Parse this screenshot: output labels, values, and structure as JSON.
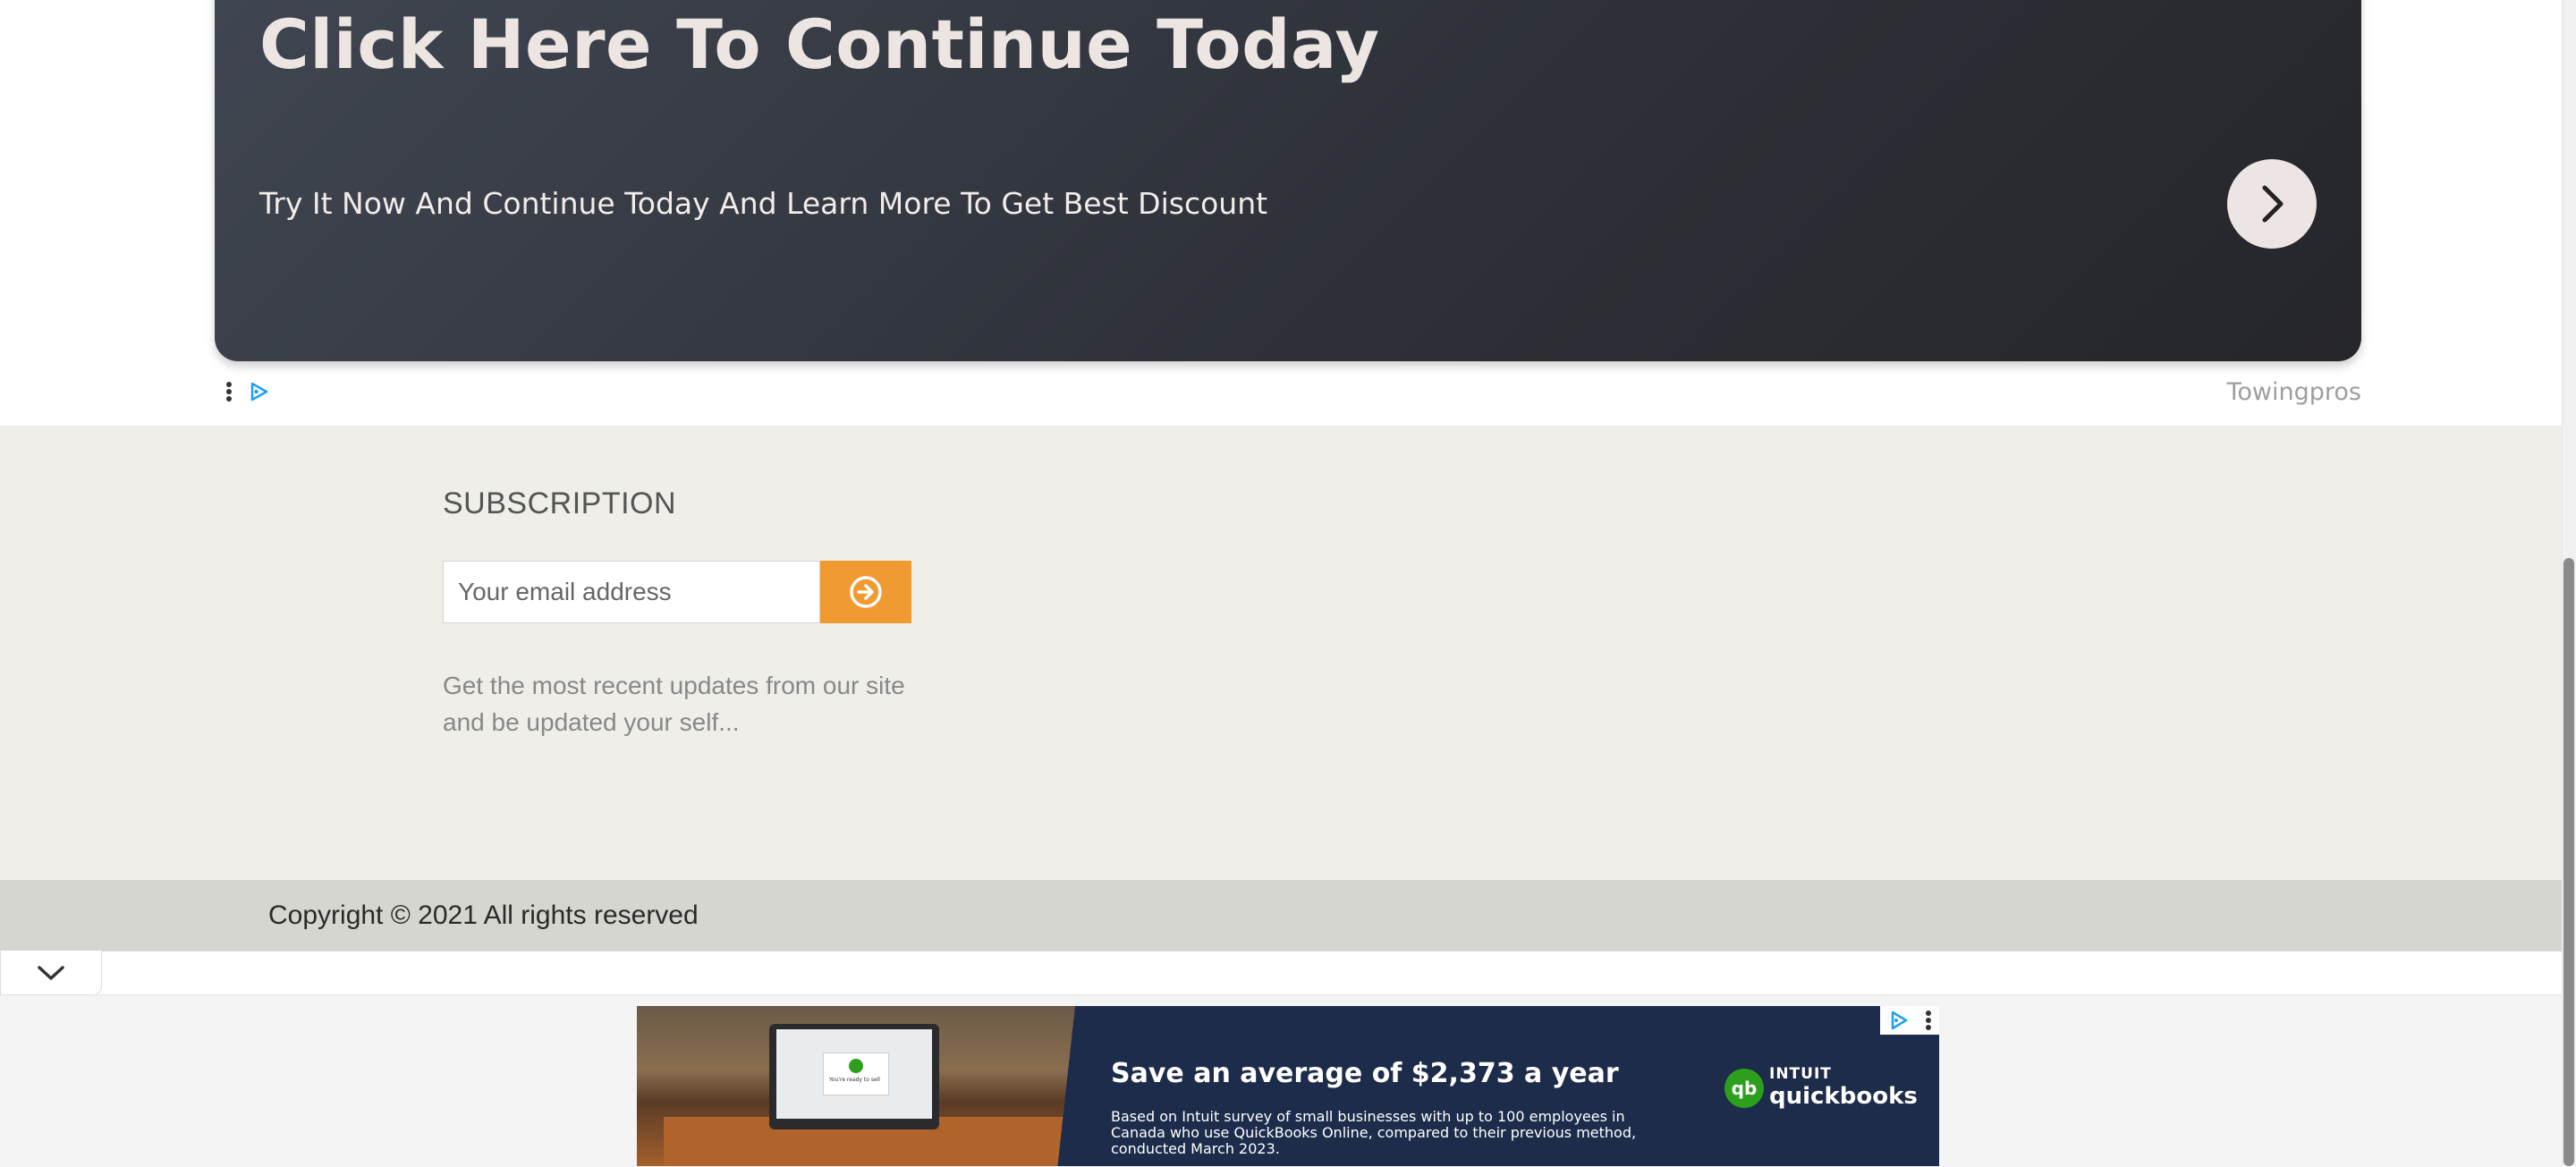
{
  "native_ad": {
    "headline": "Click Here To Continue Today",
    "subtext": "Try It Now And Continue Today And Learn More To Get Best Discount",
    "advertiser": "Towingpros",
    "cta_icon": "chevron-right-icon"
  },
  "subscription": {
    "title": "SUBSCRIPTION",
    "email_placeholder": "Your email address",
    "submit_icon": "arrow-circle-right-icon",
    "description": "Get the most recent updates from our site and be updated your self..."
  },
  "footer": {
    "copyright": "Copyright © 2021 All rights reserved"
  },
  "anchor_ad": {
    "collapse_icon": "chevron-down-icon",
    "headline": "Save an average of $2,373 a year",
    "fine_print": "Based on Intuit survey of small businesses with up to 100 employees in Canada who use QuickBooks Online, compared to their previous method, conducted March 2023.",
    "brand_intuit": "INTUIT",
    "brand_name": "quickbooks",
    "brand_mark": "qb",
    "popup_text": "You're ready to sell"
  },
  "colors": {
    "ad_dark": "#2e3138",
    "accent_orange": "#f09a32",
    "band_bg": "#efeee9",
    "footer_bg": "#d6d6d0",
    "banner_navy": "#1d2c4b",
    "quickbooks_green": "#2ca01c"
  }
}
